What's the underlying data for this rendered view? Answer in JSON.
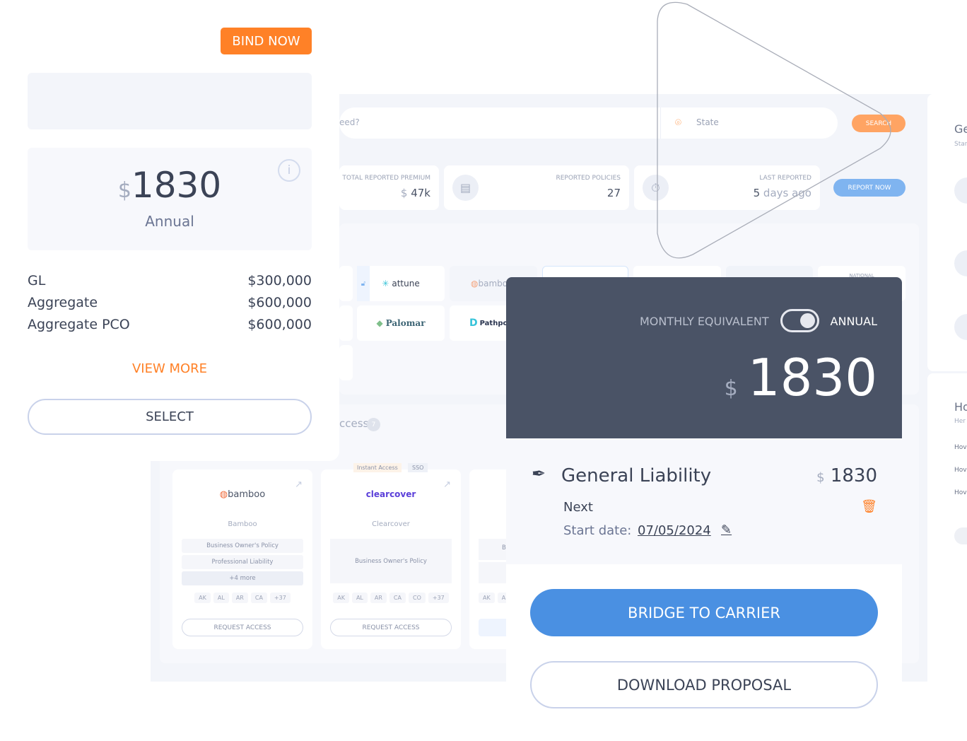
{
  "colors": {
    "accent_orange": "#ff8127",
    "primary_blue": "#4a90e2",
    "dark_panel": "#4a5366"
  },
  "quote_card": {
    "bind_label": "BIND NOW",
    "currency": "$",
    "price": "1830",
    "period": "Annual",
    "info_icon": "info-icon",
    "limits": [
      {
        "label": "GL",
        "value": "$300,000"
      },
      {
        "label": "Aggregate",
        "value": "$600,000"
      },
      {
        "label": "Aggregate PCO",
        "value": "$600,000"
      }
    ],
    "view_more": "VIEW MORE",
    "select": "SELECT"
  },
  "dashboard": {
    "search_placeholder": "eed?",
    "state_placeholder": "State",
    "search_button": "SEARCH",
    "stats": [
      {
        "label": "TOTAL REPORTED PREMIUM",
        "currency": "$",
        "value": "47k"
      },
      {
        "label": "REPORTED POLICIES",
        "value": "27"
      },
      {
        "label": "LAST REPORTED",
        "value_num": "5",
        "value_text": "days ago"
      }
    ],
    "report_now": "REPORT NOW",
    "carriers_row1": [
      "attune",
      "bamboo",
      "",
      "",
      "NATIONAL"
    ],
    "carriers_row2": [
      "Palomar",
      "Pathpo"
    ],
    "access_title": "ccess",
    "access_count": "7",
    "access_cards": [
      {
        "logo": "bamboo",
        "name": "Bamboo",
        "products": [
          "Business Owner's Policy",
          "Professional Liability",
          "+4 more"
        ],
        "states": [
          "AK",
          "AL",
          "AR",
          "CA",
          "+37"
        ],
        "button": "REQUEST ACCESS"
      },
      {
        "logo": "clearcover",
        "name": "Clearcover",
        "badges": [
          "Instant Access",
          "SSO"
        ],
        "products": [
          "Business Owner's Policy"
        ],
        "states": [
          "AK",
          "AL",
          "AR",
          "CA",
          "CO",
          "+37"
        ],
        "button": "REQUEST ACCESS"
      },
      {
        "products": [
          "B"
        ],
        "states": [
          "AK",
          "A"
        ]
      }
    ],
    "side_top": {
      "title": "Ge",
      "subtitle": "Star"
    },
    "side_bottom": {
      "title": "Ho",
      "subtitle": "Her",
      "items": [
        "Hov",
        "Hov",
        "Hov"
      ]
    }
  },
  "summary": {
    "toggle_left": "MONTHLY EQUIVALENT",
    "toggle_right": "ANNUAL",
    "toggle_on": true,
    "currency": "$",
    "price": "1830",
    "line": {
      "title": "General Liability",
      "currency": "$",
      "price": "1830",
      "status": "Next",
      "start_label": "Start date:",
      "start_date": "07/05/2024"
    },
    "bridge": "BRIDGE TO CARRIER",
    "download": "DOWNLOAD PROPOSAL"
  }
}
